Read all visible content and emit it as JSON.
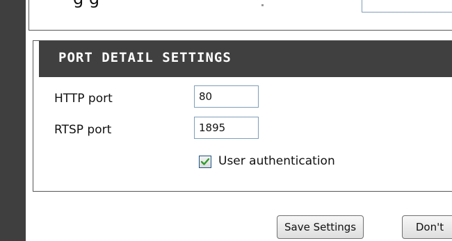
{
  "top_fragment": {
    "text": "g g"
  },
  "panel": {
    "title": "PORT DETAIL SETTINGS",
    "http_label": "HTTP port",
    "http_value": "80",
    "rtsp_label": "RTSP port",
    "rtsp_value": "1895",
    "auth_checkbox_checked": true,
    "auth_label": "User authentication"
  },
  "buttons": {
    "save_label": "Save Settings",
    "dont_save_label": "Don't"
  },
  "colors": {
    "header_bg": "#404040",
    "left_strip": "#3f3f3f",
    "input_border": "#7f9db9",
    "check_color": "#2e9c2e"
  }
}
